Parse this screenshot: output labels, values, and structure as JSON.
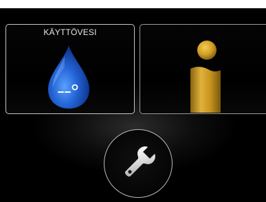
{
  "main": {
    "tiles": [
      {
        "label": "KÄYTTÖVESI",
        "icon": "water-drop-icon"
      },
      {
        "label": "",
        "icon": "info-icon"
      }
    ],
    "service_button": {
      "icon": "wrench-icon"
    }
  },
  "colors": {
    "background": "#000000",
    "drop_blue": "#1e5fd6",
    "info_gold": "#c89a2a"
  }
}
